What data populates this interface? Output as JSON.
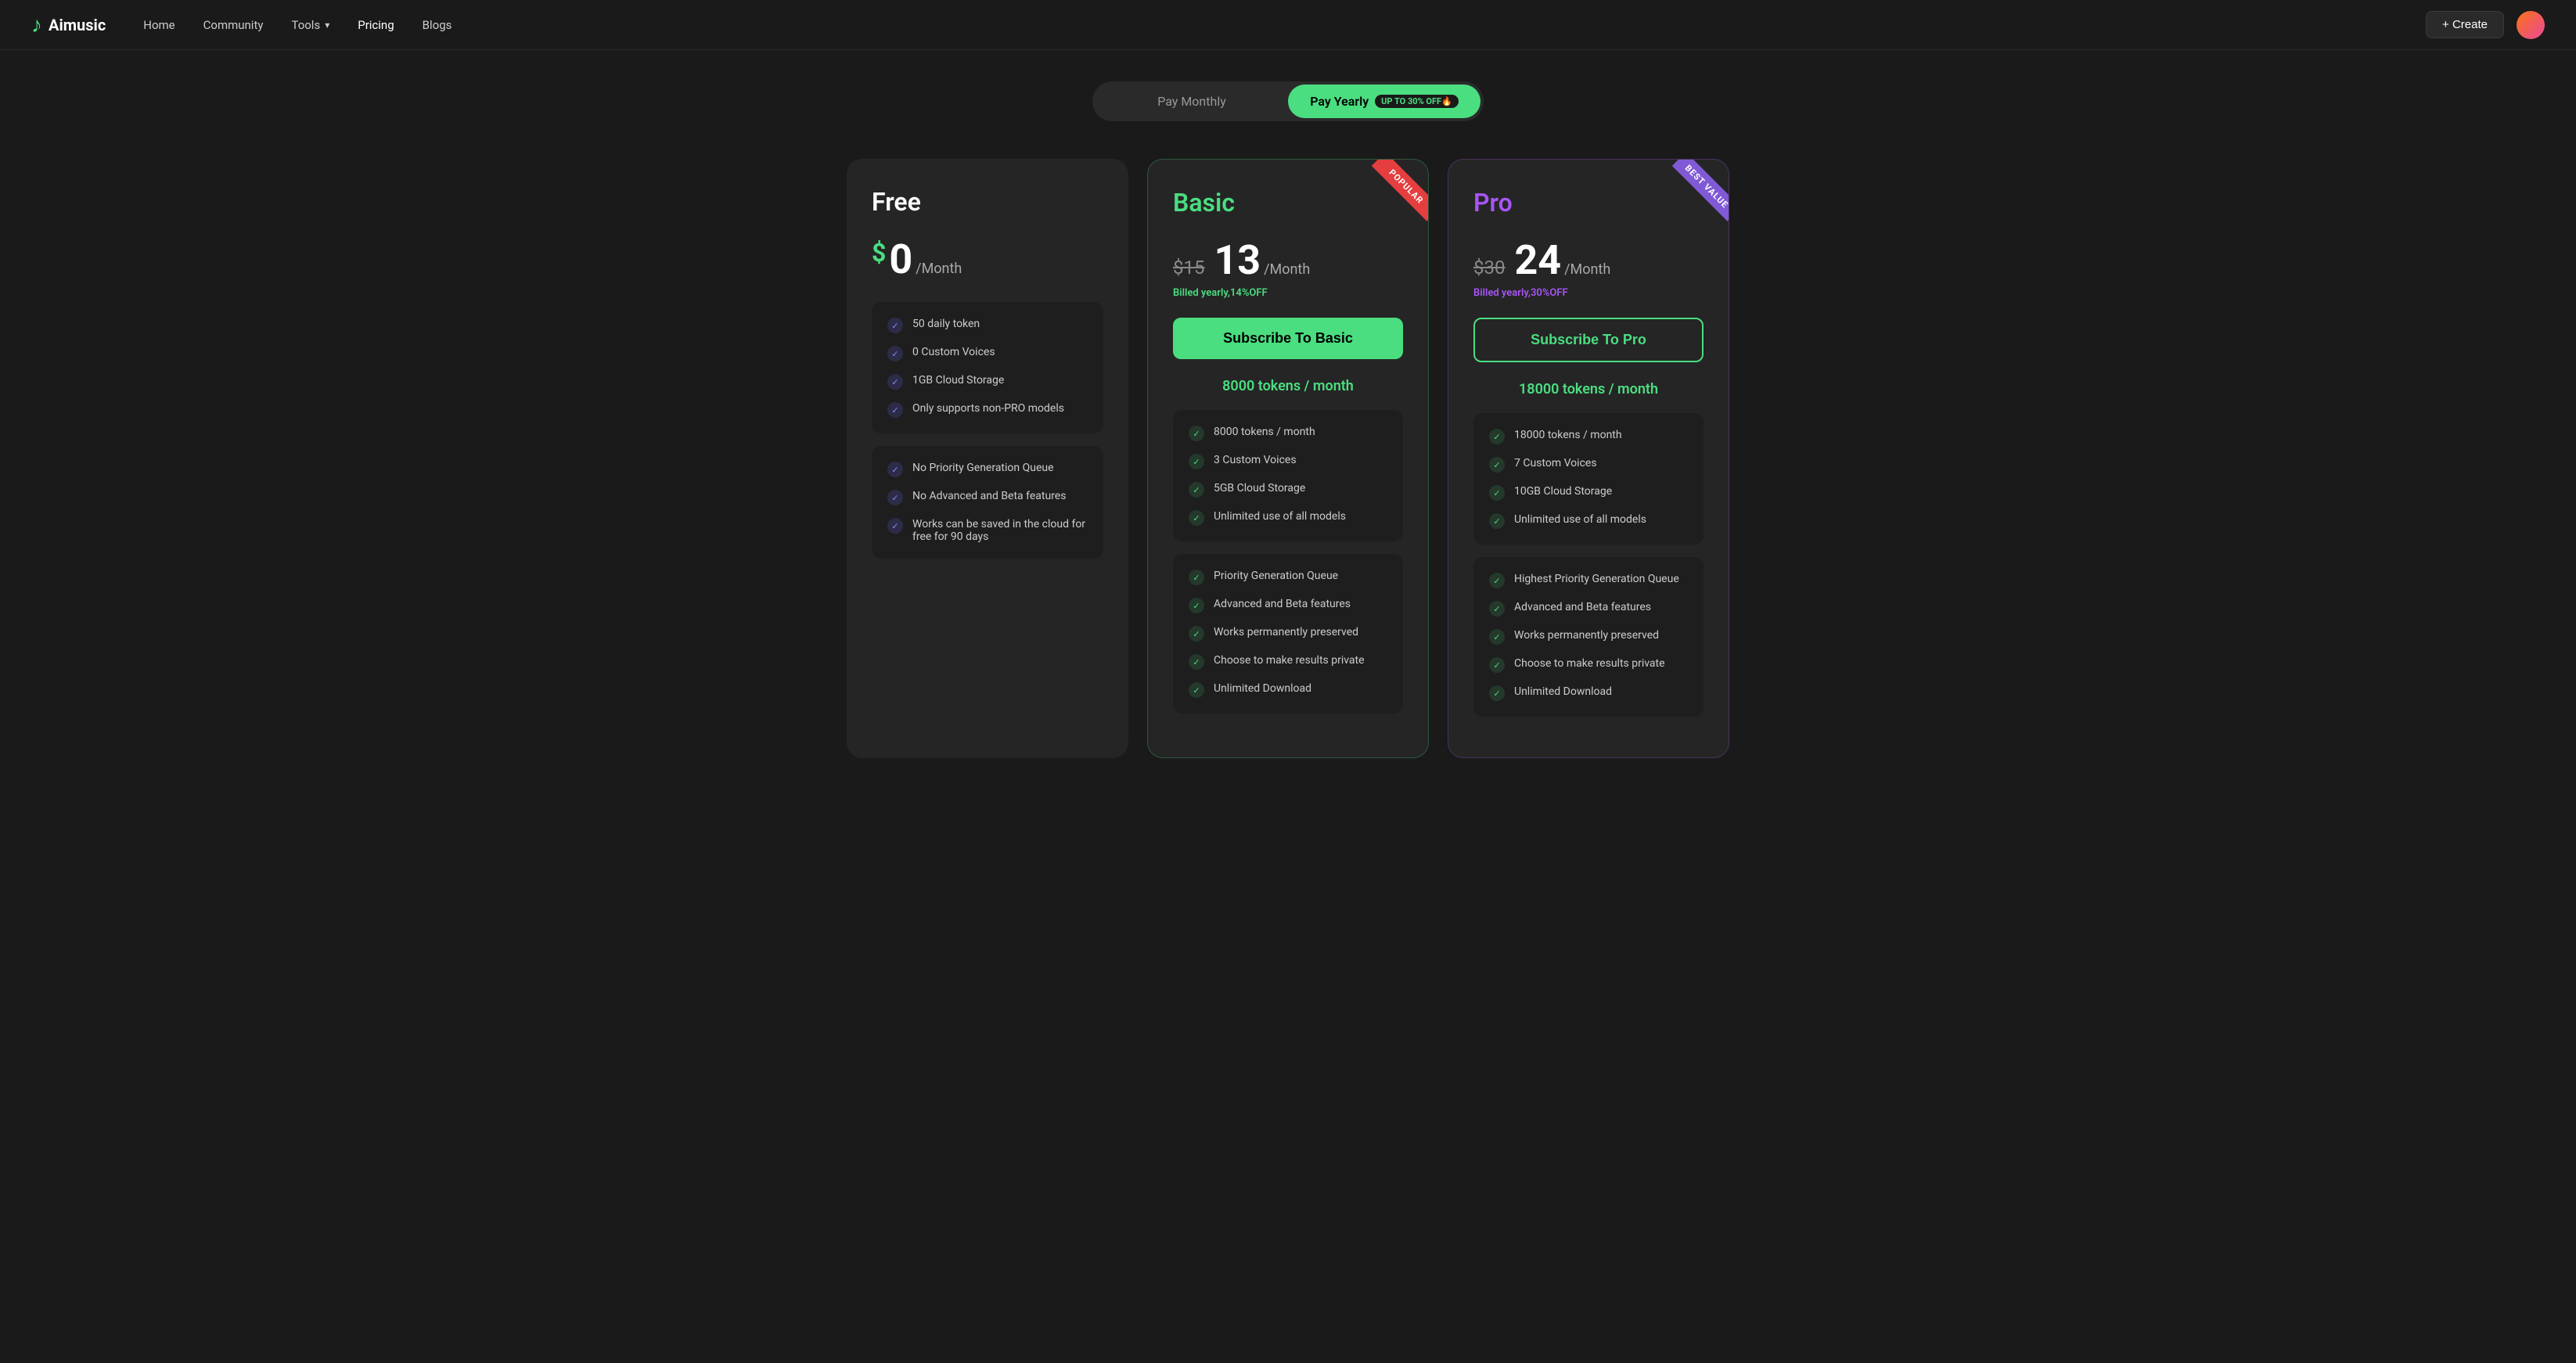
{
  "nav": {
    "logo_text": "Aimusic",
    "links": [
      {
        "label": "Home",
        "active": false
      },
      {
        "label": "Community",
        "active": false
      },
      {
        "label": "Tools",
        "active": false,
        "has_chevron": true
      },
      {
        "label": "Pricing",
        "active": true
      },
      {
        "label": "Blogs",
        "active": false
      }
    ],
    "create_label": "+ Create"
  },
  "billing": {
    "monthly_label": "Pay Monthly",
    "yearly_label": "Pay Yearly",
    "yearly_badge": "UP TO 30% OFF🔥",
    "active": "yearly"
  },
  "plans": [
    {
      "id": "free",
      "name": "Free",
      "color": "default",
      "price": "$0",
      "period": "/Month",
      "features_basic": [
        "50 daily token",
        "0 Custom Voices",
        "1GB Cloud Storage",
        "Only supports non-PRO models"
      ],
      "features_advanced": [
        "No Priority Generation Queue",
        "No Advanced and Beta features",
        "Works can be saved in the cloud for free for 90 days"
      ]
    },
    {
      "id": "basic",
      "name": "Basic",
      "color": "green",
      "ribbon": "popular",
      "price_original": "$15",
      "price": "$13",
      "period": "/Month",
      "billed": "Billed yearly,",
      "discount": "14%OFF",
      "subscribe_label": "Subscribe To Basic",
      "tokens": "8000 tokens / month",
      "features_basic": [
        "8000 tokens / month",
        "3 Custom Voices",
        "5GB Cloud Storage",
        "Unlimited use of all models"
      ],
      "features_advanced": [
        "Priority Generation Queue",
        "Advanced and Beta features",
        "Works permanently preserved",
        "Choose to make results private",
        "Unlimited Download"
      ]
    },
    {
      "id": "pro",
      "name": "Pro",
      "color": "purple",
      "ribbon": "best value",
      "price_original": "$30",
      "price": "$24",
      "period": "/Month",
      "billed": "Billed yearly,",
      "discount": "30%OFF",
      "subscribe_label": "Subscribe To Pro",
      "tokens": "18000 tokens / month",
      "features_basic": [
        "18000 tokens / month",
        "7 Custom Voices",
        "10GB Cloud Storage",
        "Unlimited use of all models"
      ],
      "features_advanced": [
        "Highest Priority Generation Queue",
        "Advanced and Beta features",
        "Works permanently preserved",
        "Choose to make results private",
        "Unlimited Download"
      ]
    }
  ]
}
